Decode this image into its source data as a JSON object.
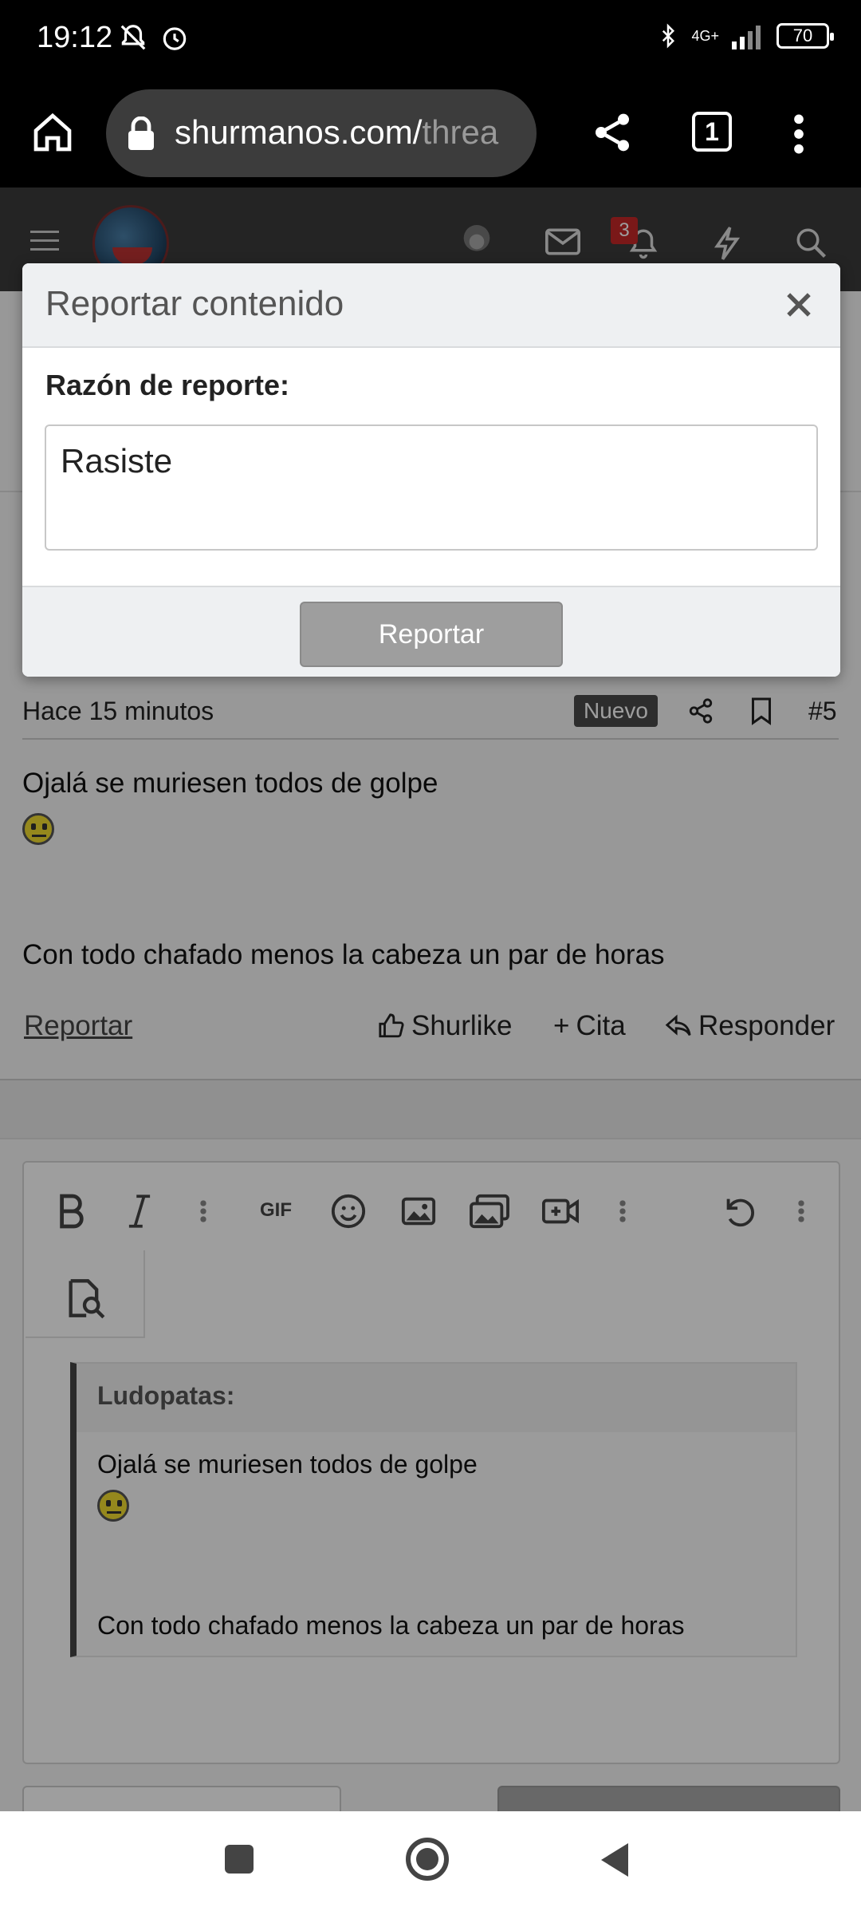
{
  "status_bar": {
    "time": "19:12",
    "network": "4G+",
    "battery": "70"
  },
  "browser": {
    "url_main": "shurmanos.com/",
    "url_faded": "threa",
    "tab_count": "1"
  },
  "site_header": {
    "notification_count": "3"
  },
  "modal": {
    "title": "Reportar contenido",
    "label": "Razón de reporte:",
    "input_value": "Rasiste",
    "submit_label": "Reportar"
  },
  "post": {
    "time": "Hace 15 minutos",
    "badge": "Nuevo",
    "number": "#5",
    "line1": "Ojalá se muriesen todos de golpe",
    "line2": "Con todo chafado menos la cabeza un par de horas",
    "actions": {
      "report": "Reportar",
      "like": "Shurlike",
      "quote": "Cita",
      "reply": "Responder"
    }
  },
  "editor": {
    "toolbar_gif": "GIF",
    "quote_author": "Ludopatas:",
    "quote_line1": "Ojalá se muriesen todos de golpe",
    "quote_line2": "Con todo chafado menos la cabeza un par de horas"
  },
  "colors": {
    "accent": "#c62828",
    "overlay": "rgba(0,0,0,0.38)"
  }
}
